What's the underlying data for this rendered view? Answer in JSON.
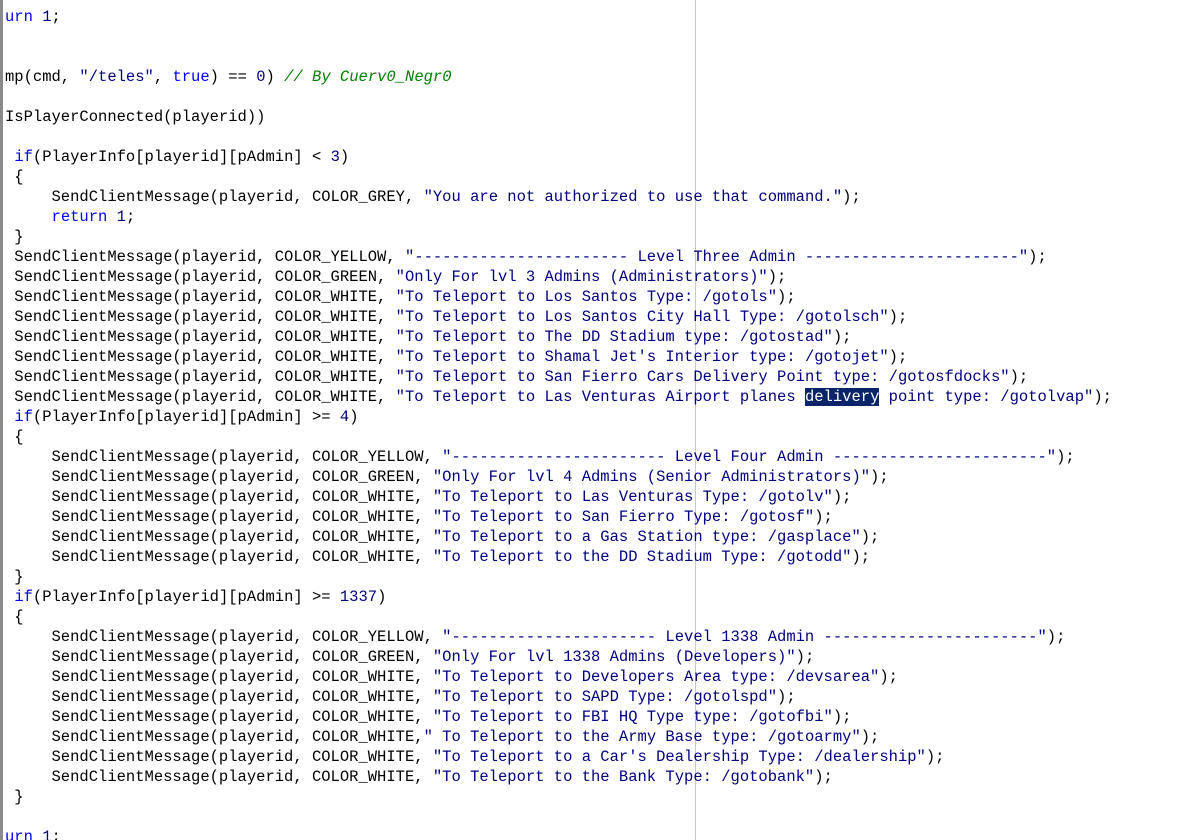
{
  "editor": {
    "selection_word": "delivery",
    "lines": [
      [
        {
          "t": "urn ",
          "k": "k"
        },
        {
          "t": "1",
          "k": "n"
        },
        {
          "t": ";",
          "k": "p"
        }
      ],
      [],
      [],
      [
        {
          "t": "mp(cmd, ",
          "k": "p"
        },
        {
          "t": "\"/teles\"",
          "k": "s"
        },
        {
          "t": ", ",
          "k": "p"
        },
        {
          "t": "true",
          "k": "k"
        },
        {
          "t": ") == ",
          "k": "p"
        },
        {
          "t": "0",
          "k": "n"
        },
        {
          "t": ") ",
          "k": "p"
        },
        {
          "t": "// By Cuerv0_Negr0",
          "k": "c"
        }
      ],
      [],
      [
        {
          "t": "IsPlayerConnected(playerid))",
          "k": "p"
        }
      ],
      [],
      [
        {
          "t": " ",
          "k": "p"
        },
        {
          "t": "if",
          "k": "k"
        },
        {
          "t": "(PlayerInfo[playerid][pAdmin] < ",
          "k": "p"
        },
        {
          "t": "3",
          "k": "n"
        },
        {
          "t": ")",
          "k": "p"
        }
      ],
      [
        {
          "t": " {",
          "k": "p"
        }
      ],
      [
        {
          "t": "     SendClientMessage(playerid, COLOR_GREY, ",
          "k": "p"
        },
        {
          "t": "\"You are not authorized to use that command.\"",
          "k": "s"
        },
        {
          "t": ");",
          "k": "p"
        }
      ],
      [
        {
          "t": "     ",
          "k": "p"
        },
        {
          "t": "return",
          "k": "k"
        },
        {
          "t": " ",
          "k": "p"
        },
        {
          "t": "1",
          "k": "n"
        },
        {
          "t": ";",
          "k": "p"
        }
      ],
      [
        {
          "t": " }",
          "k": "p"
        }
      ],
      [
        {
          "t": " SendClientMessage(playerid, COLOR_YELLOW, ",
          "k": "p"
        },
        {
          "t": "\"----------------------- Level Three Admin -----------------------\"",
          "k": "s"
        },
        {
          "t": ");",
          "k": "p"
        }
      ],
      [
        {
          "t": " SendClientMessage(playerid, COLOR_GREEN, ",
          "k": "p"
        },
        {
          "t": "\"Only For lvl 3 Admins (Administrators)\"",
          "k": "s"
        },
        {
          "t": ");",
          "k": "p"
        }
      ],
      [
        {
          "t": " SendClientMessage(playerid, COLOR_WHITE, ",
          "k": "p"
        },
        {
          "t": "\"To Teleport to Los Santos Type: /gotols\"",
          "k": "s"
        },
        {
          "t": ");",
          "k": "p"
        }
      ],
      [
        {
          "t": " SendClientMessage(playerid, COLOR_WHITE, ",
          "k": "p"
        },
        {
          "t": "\"To Teleport to Los Santos City Hall Type: /gotolsch\"",
          "k": "s"
        },
        {
          "t": ");",
          "k": "p"
        }
      ],
      [
        {
          "t": " SendClientMessage(playerid, COLOR_WHITE, ",
          "k": "p"
        },
        {
          "t": "\"To Teleport to The DD Stadium type: /gotostad\"",
          "k": "s"
        },
        {
          "t": ");",
          "k": "p"
        }
      ],
      [
        {
          "t": " SendClientMessage(playerid, COLOR_WHITE, ",
          "k": "p"
        },
        {
          "t": "\"To Teleport to Shamal Jet's Interior type: /gotojet\"",
          "k": "s"
        },
        {
          "t": ");",
          "k": "p"
        }
      ],
      [
        {
          "t": " SendClientMessage(playerid, COLOR_WHITE, ",
          "k": "p"
        },
        {
          "t": "\"To Teleport to San Fierro Cars Delivery Point type: /gotosfdocks\"",
          "k": "s"
        },
        {
          "t": ");",
          "k": "p"
        }
      ],
      [
        {
          "t": " SendClientMessage(playerid, COLOR_WHITE, ",
          "k": "p"
        },
        {
          "t": "\"To Teleport to Las Venturas Airport planes ",
          "k": "s"
        },
        {
          "t": "delivery",
          "k": "sel"
        },
        {
          "t": " point type: /gotolvap\"",
          "k": "s"
        },
        {
          "t": ");",
          "k": "p"
        }
      ],
      [
        {
          "t": " ",
          "k": "p"
        },
        {
          "t": "if",
          "k": "k"
        },
        {
          "t": "(PlayerInfo[playerid][pAdmin] >= ",
          "k": "p"
        },
        {
          "t": "4",
          "k": "n"
        },
        {
          "t": ")",
          "k": "p"
        }
      ],
      [
        {
          "t": " {",
          "k": "p"
        }
      ],
      [
        {
          "t": "     SendClientMessage(playerid, COLOR_YELLOW, ",
          "k": "p"
        },
        {
          "t": "\"----------------------- Level Four Admin -----------------------\"",
          "k": "s"
        },
        {
          "t": ");",
          "k": "p"
        }
      ],
      [
        {
          "t": "     SendClientMessage(playerid, COLOR_GREEN, ",
          "k": "p"
        },
        {
          "t": "\"Only For lvl 4 Admins (Senior Administrators)\"",
          "k": "s"
        },
        {
          "t": ");",
          "k": "p"
        }
      ],
      [
        {
          "t": "     SendClientMessage(playerid, COLOR_WHITE, ",
          "k": "p"
        },
        {
          "t": "\"To Teleport to Las Venturas Type: /gotolv\"",
          "k": "s"
        },
        {
          "t": ");",
          "k": "p"
        }
      ],
      [
        {
          "t": "     SendClientMessage(playerid, COLOR_WHITE, ",
          "k": "p"
        },
        {
          "t": "\"To Teleport to San Fierro Type: /gotosf\"",
          "k": "s"
        },
        {
          "t": ");",
          "k": "p"
        }
      ],
      [
        {
          "t": "     SendClientMessage(playerid, COLOR_WHITE, ",
          "k": "p"
        },
        {
          "t": "\"To Teleport to a Gas Station type: /gasplace\"",
          "k": "s"
        },
        {
          "t": ");",
          "k": "p"
        }
      ],
      [
        {
          "t": "     SendClientMessage(playerid, COLOR_WHITE, ",
          "k": "p"
        },
        {
          "t": "\"To Teleport to the DD Stadium Type: /gotodd\"",
          "k": "s"
        },
        {
          "t": ");",
          "k": "p"
        }
      ],
      [
        {
          "t": " }",
          "k": "p"
        }
      ],
      [
        {
          "t": " ",
          "k": "p"
        },
        {
          "t": "if",
          "k": "k"
        },
        {
          "t": "(PlayerInfo[playerid][pAdmin] >= ",
          "k": "p"
        },
        {
          "t": "1337",
          "k": "n"
        },
        {
          "t": ")",
          "k": "p"
        }
      ],
      [
        {
          "t": " {",
          "k": "p"
        }
      ],
      [
        {
          "t": "     SendClientMessage(playerid, COLOR_YELLOW, ",
          "k": "p"
        },
        {
          "t": "\"---------------------- Level 1338 Admin -----------------------\"",
          "k": "s"
        },
        {
          "t": ");",
          "k": "p"
        }
      ],
      [
        {
          "t": "     SendClientMessage(playerid, COLOR_GREEN, ",
          "k": "p"
        },
        {
          "t": "\"Only For lvl 1338 Admins (Developers)\"",
          "k": "s"
        },
        {
          "t": ");",
          "k": "p"
        }
      ],
      [
        {
          "t": "     SendClientMessage(playerid, COLOR_WHITE, ",
          "k": "p"
        },
        {
          "t": "\"To Teleport to Developers Area type: /devsarea\"",
          "k": "s"
        },
        {
          "t": ");",
          "k": "p"
        }
      ],
      [
        {
          "t": "     SendClientMessage(playerid, COLOR_WHITE, ",
          "k": "p"
        },
        {
          "t": "\"To Teleport to SAPD Type: /gotolspd\"",
          "k": "s"
        },
        {
          "t": ");",
          "k": "p"
        }
      ],
      [
        {
          "t": "     SendClientMessage(playerid, COLOR_WHITE, ",
          "k": "p"
        },
        {
          "t": "\"To Teleport to FBI HQ Type type: /gotofbi\"",
          "k": "s"
        },
        {
          "t": ");",
          "k": "p"
        }
      ],
      [
        {
          "t": "     SendClientMessage(playerid, COLOR_WHITE,",
          "k": "p"
        },
        {
          "t": "\" To Teleport to the Army Base type: /gotoarmy\"",
          "k": "s"
        },
        {
          "t": ");",
          "k": "p"
        }
      ],
      [
        {
          "t": "     SendClientMessage(playerid, COLOR_WHITE, ",
          "k": "p"
        },
        {
          "t": "\"To Teleport to a Car's Dealership Type: /dealership\"",
          "k": "s"
        },
        {
          "t": ");",
          "k": "p"
        }
      ],
      [
        {
          "t": "     SendClientMessage(playerid, COLOR_WHITE, ",
          "k": "p"
        },
        {
          "t": "\"To Teleport to the Bank Type: /gotobank\"",
          "k": "s"
        },
        {
          "t": ");",
          "k": "p"
        }
      ],
      [
        {
          "t": " }",
          "k": "p"
        }
      ],
      [],
      [
        {
          "t": "urn ",
          "k": "k"
        },
        {
          "t": "1",
          "k": "n"
        },
        {
          "t": ";",
          "k": "p"
        }
      ]
    ]
  }
}
